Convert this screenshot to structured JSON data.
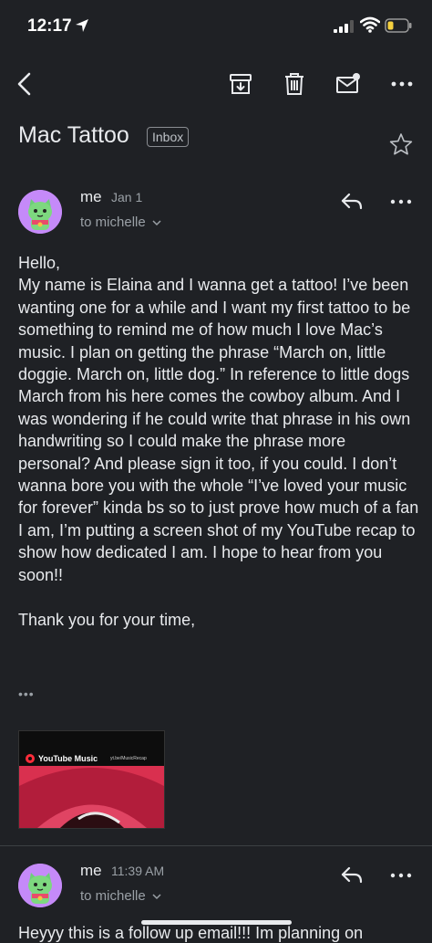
{
  "status_bar": {
    "time": "12:17",
    "icons": [
      "location-arrow-icon",
      "cellular-signal-icon",
      "wifi-icon",
      "battery-low-icon"
    ],
    "battery_color": "#f4d03f"
  },
  "toolbar": {
    "icons": [
      "back-icon",
      "archive-icon",
      "trash-icon",
      "mark-unread-icon",
      "more-icon"
    ]
  },
  "email": {
    "subject": "Mac Tattoo",
    "label": "Inbox",
    "messages": [
      {
        "sender": "me",
        "date": "Jan 1",
        "to": "to michelle",
        "body": "Hello,\nMy name is Elaina and I wanna get a tattoo! I’ve been wanting one for a while and I want my first tattoo to be something to remind me of how much I love Mac’s music. I plan on getting the phrase “March on, little doggie. March on, little dog.” In reference to little dogs March from his here comes the cowboy album. And I was wondering if he could write that phrase in his own handwriting so I could make the phrase more personal? And please sign it too, if you could. I don’t wanna bore you with the whole “I’ve loved your music for forever” kinda bs so to just prove how much of a fan I am, I’m putting a screen shot of my YouTube recap to show how dedicated I am. I hope to hear from you soon!!\n\nThank you for your time,",
        "trimmed_indicator": "•••",
        "attachment": {
          "brand": "YouTube Music",
          "url": "yt.be/MusicRecap"
        }
      },
      {
        "sender": "me",
        "date": "11:39 AM",
        "to": "to michelle",
        "body_preview": "Heyyy this is a follow up email!!! Im planning on"
      }
    ]
  },
  "colors": {
    "background": "#1f2125",
    "text": "#e8eaed",
    "muted": "#9aa0a6",
    "avatar": "#c58af9"
  }
}
